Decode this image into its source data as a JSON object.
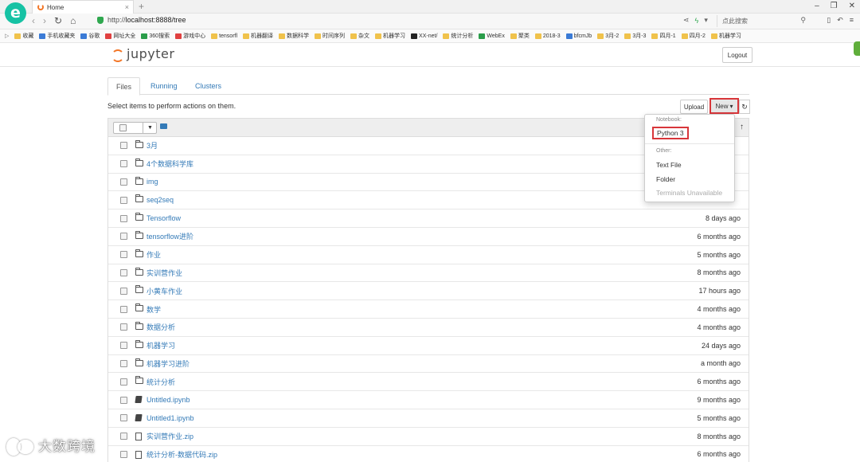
{
  "browser": {
    "tab_title": "Home",
    "url_prefix": "http://",
    "url_host": "localhost:8888/tree",
    "search_placeholder": "点此搜索",
    "bookmarks": [
      {
        "label": "收藏",
        "color": "#f0c24b"
      },
      {
        "label": "手机收藏夹",
        "color": "#3b7bd6"
      },
      {
        "label": "谷歌",
        "color": "#3b7bd6"
      },
      {
        "label": "网址大全",
        "color": "#e04040"
      },
      {
        "label": "360搜索",
        "color": "#2a9d4a"
      },
      {
        "label": "游戏中心",
        "color": "#e04040"
      },
      {
        "label": "tensorfl",
        "color": "#f0c24b"
      },
      {
        "label": "机器翻译",
        "color": "#f0c24b"
      },
      {
        "label": "数据科学",
        "color": "#f0c24b"
      },
      {
        "label": "时间序列",
        "color": "#f0c24b"
      },
      {
        "label": "杂文",
        "color": "#f0c24b"
      },
      {
        "label": "机器学习",
        "color": "#f0c24b"
      },
      {
        "label": "XX-net/",
        "color": "#222222"
      },
      {
        "label": "统计分析",
        "color": "#f0c24b"
      },
      {
        "label": "WebEx",
        "color": "#2a9d4a"
      },
      {
        "label": "聚类",
        "color": "#f0c24b"
      },
      {
        "label": "2018-3",
        "color": "#f0c24b"
      },
      {
        "label": "bfcmJb",
        "color": "#3b7bd6"
      },
      {
        "label": "3月-2",
        "color": "#f0c24b"
      },
      {
        "label": "3月-3",
        "color": "#f0c24b"
      },
      {
        "label": "四月-1",
        "color": "#f0c24b"
      },
      {
        "label": "四月-2",
        "color": "#f0c24b"
      },
      {
        "label": "机器学习",
        "color": "#f0c24b"
      }
    ]
  },
  "jupyter": {
    "logo_text": "jupyter",
    "logout_label": "Logout",
    "tabs": [
      "Files",
      "Running",
      "Clusters"
    ],
    "hint": "Select items to perform actions on them.",
    "upload_label": "Upload",
    "new_label": "New",
    "files": [
      {
        "name": "3月",
        "type": "folder",
        "time": ""
      },
      {
        "name": "4个数据科学库",
        "type": "folder",
        "time": ""
      },
      {
        "name": "img",
        "type": "folder",
        "time": ""
      },
      {
        "name": "seq2seq",
        "type": "folder",
        "time": ""
      },
      {
        "name": "Tensorflow",
        "type": "folder",
        "time": "8 days ago"
      },
      {
        "name": "tensorflow进阶",
        "type": "folder",
        "time": "6 months ago"
      },
      {
        "name": "作业",
        "type": "folder",
        "time": "5 months ago"
      },
      {
        "name": "实训营作业",
        "type": "folder",
        "time": "8 months ago"
      },
      {
        "name": "小黄车作业",
        "type": "folder",
        "time": "17 hours ago"
      },
      {
        "name": "数学",
        "type": "folder",
        "time": "4 months ago"
      },
      {
        "name": "数据分析",
        "type": "folder",
        "time": "4 months ago"
      },
      {
        "name": "机器学习",
        "type": "folder",
        "time": "24 days ago"
      },
      {
        "name": "机器学习进阶",
        "type": "folder",
        "time": "a month ago"
      },
      {
        "name": "统计分析",
        "type": "folder",
        "time": "6 months ago"
      },
      {
        "name": "Untitled.ipynb",
        "type": "notebook",
        "time": "9 months ago"
      },
      {
        "name": "Untitled1.ipynb",
        "type": "notebook",
        "time": "5 months ago"
      },
      {
        "name": "实训营作业.zip",
        "type": "file",
        "time": "8 months ago"
      },
      {
        "name": "统计分析-数据代码.zip",
        "type": "file",
        "time": "6 months ago"
      }
    ],
    "new_menu": {
      "notebook_header": "Notebook:",
      "python3": "Python 3",
      "other_header": "Other:",
      "text_file": "Text File",
      "folder": "Folder",
      "terminals": "Terminals Unavailable"
    }
  },
  "watermark": "大数跨境"
}
